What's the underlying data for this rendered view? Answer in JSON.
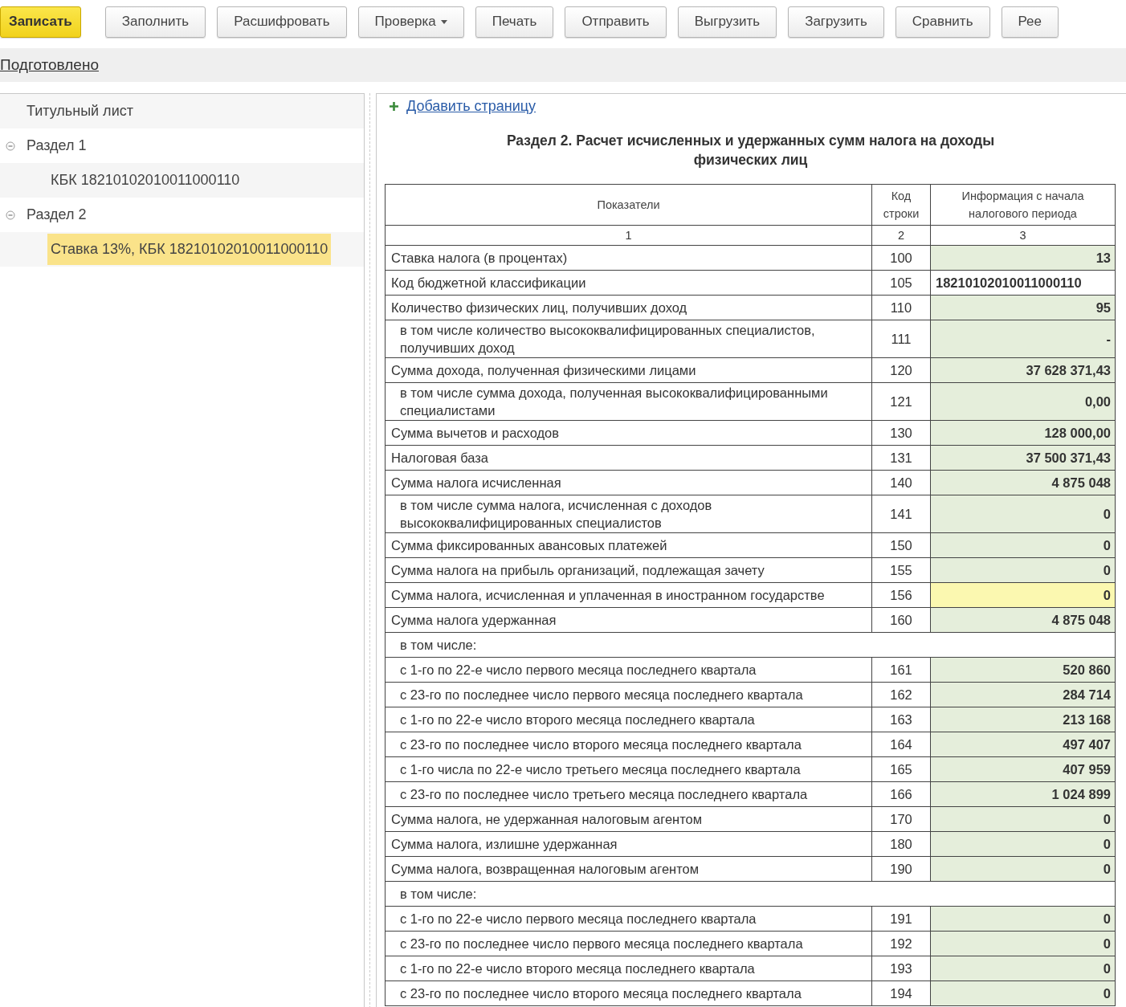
{
  "toolbar": {
    "buttons": [
      {
        "label": "Записать",
        "kind": "primary",
        "has_menu": false
      },
      {
        "label": "Заполнить",
        "kind": "normal",
        "has_menu": false
      },
      {
        "label": "Расшифровать",
        "kind": "normal",
        "has_menu": false
      },
      {
        "label": "Проверка",
        "kind": "normal",
        "has_menu": true
      },
      {
        "label": "Печать",
        "kind": "normal",
        "has_menu": false
      },
      {
        "label": "Отправить",
        "kind": "normal",
        "has_menu": false
      },
      {
        "label": "Выгрузить",
        "kind": "normal",
        "has_menu": false
      },
      {
        "label": "Загрузить",
        "kind": "normal",
        "has_menu": false
      },
      {
        "label": "Сравнить",
        "kind": "normal",
        "has_menu": false
      },
      {
        "label": "Рее",
        "kind": "normal",
        "has_menu": false
      }
    ]
  },
  "status_bar": {
    "link": "Подготовлено"
  },
  "sidebar": {
    "items": [
      {
        "label": "Титульный лист"
      },
      {
        "label": "Раздел 1",
        "expanded": true,
        "children": [
          {
            "label": "КБК 18210102010011000110",
            "selected": false
          }
        ]
      },
      {
        "label": "Раздел 2",
        "expanded": true,
        "children": [
          {
            "label": "Ставка 13%, КБК 18210102010011000110",
            "selected": true
          }
        ]
      }
    ]
  },
  "form": {
    "add_page_link": "Добавить страницу",
    "title": "Раздел 2. Расчет исчисленных и удержанных сумм налога на доходы физических лиц",
    "table": {
      "columns": [
        "Показатели",
        "Код строки",
        "Информация с начала налогового периода"
      ],
      "column_numbers": [
        "1",
        "2",
        "3"
      ],
      "rows": [
        {
          "kind": "value",
          "label": "Ставка налога (в процентах)",
          "code": "100",
          "value": "13",
          "indented": false,
          "selected": false
        },
        {
          "kind": "code",
          "label": "Код бюджетной классификации",
          "code": "105",
          "value": "18210102010011000110",
          "indented": false
        },
        {
          "kind": "value",
          "label": "Количество физических лиц, получивших доход",
          "code": "110",
          "value": "95",
          "indented": false,
          "selected": false
        },
        {
          "kind": "value",
          "label": "в том числе количество высококвалифицированных специалистов, получивших доход",
          "code": "111",
          "value": "-",
          "indented": true,
          "selected": false
        },
        {
          "kind": "value",
          "label": "Сумма дохода, полученная физическими лицами",
          "code": "120",
          "value": "37 628 371,43",
          "indented": false,
          "selected": false
        },
        {
          "kind": "value",
          "label": "в том числе сумма дохода, полученная высококвалифицированными специалистами",
          "code": "121",
          "value": "0,00",
          "indented": true,
          "selected": false
        },
        {
          "kind": "value",
          "label": "Сумма вычетов и расходов",
          "code": "130",
          "value": "128 000,00",
          "indented": false,
          "selected": false
        },
        {
          "kind": "value",
          "label": "Налоговая база",
          "code": "131",
          "value": "37 500 371,43",
          "indented": false,
          "selected": false
        },
        {
          "kind": "value",
          "label": "Сумма налога исчисленная",
          "code": "140",
          "value": "4 875 048",
          "indented": false,
          "selected": false
        },
        {
          "kind": "value",
          "label": "в том числе сумма налога, исчисленная с доходов высококвалифицированных специалистов",
          "code": "141",
          "value": "0",
          "indented": true,
          "selected": false
        },
        {
          "kind": "value",
          "label": "Сумма фиксированных авансовых платежей",
          "code": "150",
          "value": "0",
          "indented": false,
          "selected": false
        },
        {
          "kind": "value",
          "label": "Сумма налога на прибыль организаций, подлежащая зачету",
          "code": "155",
          "value": "0",
          "indented": false,
          "selected": false
        },
        {
          "kind": "value",
          "label": "Сумма налога, исчисленная и уплаченная в иностранном государстве",
          "code": "156",
          "value": "0",
          "indented": false,
          "selected": true
        },
        {
          "kind": "value",
          "label": "Сумма налога удержанная",
          "code": "160",
          "value": "4 875 048",
          "indented": false,
          "selected": false
        },
        {
          "kind": "subheading",
          "label": "в том числе:",
          "indented": true
        },
        {
          "kind": "value",
          "label": "с 1-го по 22-е число первого месяца последнего квартала",
          "code": "161",
          "value": "520 860",
          "indented": true,
          "selected": false
        },
        {
          "kind": "value",
          "label": "с 23-го по последнее число первого месяца последнего квартала",
          "code": "162",
          "value": "284 714",
          "indented": true,
          "selected": false
        },
        {
          "kind": "value",
          "label": "с 1-го по 22-е число второго месяца последнего квартала",
          "code": "163",
          "value": "213 168",
          "indented": true,
          "selected": false
        },
        {
          "kind": "value",
          "label": "с 23-го по последнее число второго месяца последнего квартала",
          "code": "164",
          "value": "497 407",
          "indented": true,
          "selected": false
        },
        {
          "kind": "value",
          "label": "с 1-го числа по 22-е число третьего месяца последнего квартала",
          "code": "165",
          "value": "407 959",
          "indented": true,
          "selected": false
        },
        {
          "kind": "value",
          "label": "с 23-го по последнее число третьего месяца последнего квартала",
          "code": "166",
          "value": "1 024 899",
          "indented": true,
          "selected": false
        },
        {
          "kind": "value",
          "label": "Сумма налога, не удержанная налоговым агентом",
          "code": "170",
          "value": "0",
          "indented": false,
          "selected": false
        },
        {
          "kind": "value",
          "label": "Сумма налога, излишне удержанная",
          "code": "180",
          "value": "0",
          "indented": false,
          "selected": false
        },
        {
          "kind": "value",
          "label": "Сумма налога, возвращенная налоговым агентом",
          "code": "190",
          "value": "0",
          "indented": false,
          "selected": false
        },
        {
          "kind": "subheading",
          "label": "в том числе:",
          "indented": true
        },
        {
          "kind": "value",
          "label": "с 1-го по 22-е число первого месяца последнего квартала",
          "code": "191",
          "value": "0",
          "indented": true,
          "selected": false
        },
        {
          "kind": "value",
          "label": "с 23-го по последнее число первого месяца последнего квартала",
          "code": "192",
          "value": "0",
          "indented": true,
          "selected": false
        },
        {
          "kind": "value",
          "label": "с 1-го по 22-е число второго месяца последнего квартала",
          "code": "193",
          "value": "0",
          "indented": true,
          "selected": false
        },
        {
          "kind": "value",
          "label": "с 23-го по последнее число второго месяца последнего квартала",
          "code": "194",
          "value": "0",
          "indented": true,
          "selected": false
        }
      ]
    }
  }
}
